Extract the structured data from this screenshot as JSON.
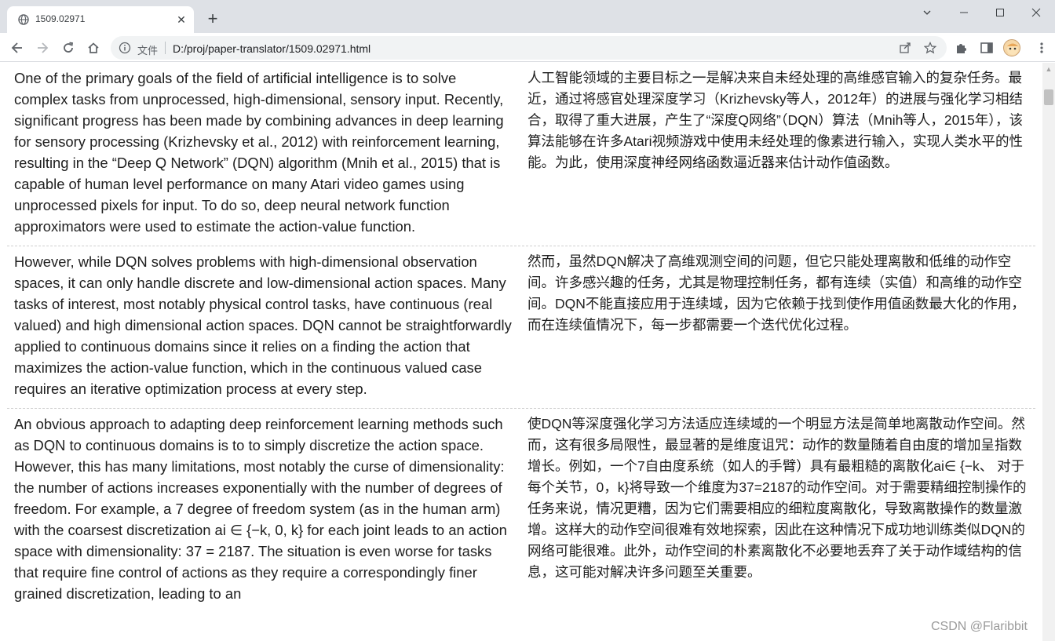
{
  "browser": {
    "tab_title": "1509.02971",
    "tab_close": "✕",
    "new_tab": "+",
    "scheme_label": "文件",
    "url": "D:/proj/paper-translator/1509.02971.html"
  },
  "paragraphs": [
    {
      "en": "One of the primary goals of the field of artificial intelligence is to solve complex tasks from unprocessed, high-dimensional, sensory input. Recently, significant progress has been made by combining advances in deep learning for sensory processing (Krizhevsky et al., 2012) with reinforcement learning, resulting in the “Deep Q Network” (DQN) algorithm (Mnih et al., 2015) that is capable of human level performance on many Atari video games using unprocessed pixels for input. To do so, deep neural network function approximators were used to estimate the action-value function.",
      "zh": "人工智能领域的主要目标之一是解决来自未经处理的高维感官输入的复杂任务。最近，通过将感官处理深度学习（Krizhevsky等人，2012年）的进展与强化学习相结合，取得了重大进展，产生了“深度Q网络”（DQN）算法（Mnih等人，2015年），该算法能够在许多Atari视频游戏中使用未经处理的像素进行输入，实现人类水平的性能。为此，使用深度神经网络函数逼近器来估计动作值函数。"
    },
    {
      "en": "However, while DQN solves problems with high-dimensional observation spaces, it can only handle discrete and low-dimensional action spaces. Many tasks of interest, most notably physical control tasks, have continuous (real valued) and high dimensional action spaces. DQN cannot be straightforwardly applied to continuous domains since it relies on a finding the action that maximizes the action-value function, which in the continuous valued case requires an iterative optimization process at every step.",
      "zh": "然而，虽然DQN解决了高维观测空间的问题，但它只能处理离散和低维的动作空间。许多感兴趣的任务，尤其是物理控制任务，都有连续（实值）和高维的动作空间。DQN不能直接应用于连续域，因为它依赖于找到使作用值函数最大化的作用，而在连续值情况下，每一步都需要一个迭代优化过程。"
    },
    {
      "en": "An obvious approach to adapting deep reinforcement learning methods such as DQN to continuous domains is to to simply discretize the action space. However, this has many limitations, most notably the curse of dimensionality: the number of actions increases exponentially with the number of degrees of freedom. For example, a 7 degree of freedom system (as in the human arm) with the coarsest discretization ai ∈ {−k, 0, k} for each joint leads to an action space with dimensionality: 37 = 2187. The situation is even worse for tasks that require fine control of actions as they require a correspondingly finer grained discretization, leading to an",
      "zh": "使DQN等深度强化学习方法适应连续域的一个明显方法是简单地离散动作空间。然而，这有很多局限性，最显著的是维度诅咒：动作的数量随着自由度的增加呈指数增长。例如，一个7自由度系统（如人的手臂）具有最粗糙的离散化ai∈ {−k、 对于每个关节，0，k}将导致一个维度为37=2187的动作空间。对于需要精细控制操作的任务来说，情况更糟，因为它们需要相应的细粒度离散化，导致离散操作的数量激增。这样大的动作空间很难有效地探索，因此在这种情况下成功地训练类似DQN的网络可能很难。此外，动作空间的朴素离散化不必要地丢弃了关于动作域结构的信息，这可能对解决许多问题至关重要。"
    }
  ],
  "watermark": "CSDN @Flaribbit"
}
